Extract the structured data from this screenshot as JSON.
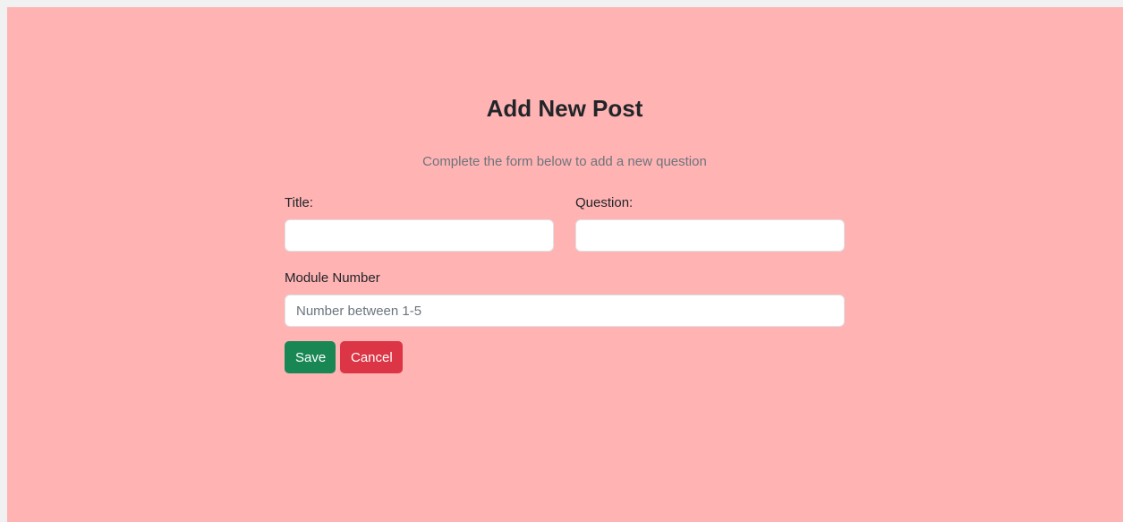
{
  "form": {
    "heading": "Add New Post",
    "subtitle": "Complete the form below to add a new question",
    "title_label": "Title:",
    "title_value": "",
    "question_label": "Question:",
    "question_value": "",
    "module_label": "Module Number",
    "module_value": "",
    "module_placeholder": "Number between 1-5",
    "save_label": "Save",
    "cancel_label": "Cancel"
  },
  "colors": {
    "background": "#ffb3b3",
    "save": "#198754",
    "cancel": "#dc3545"
  }
}
